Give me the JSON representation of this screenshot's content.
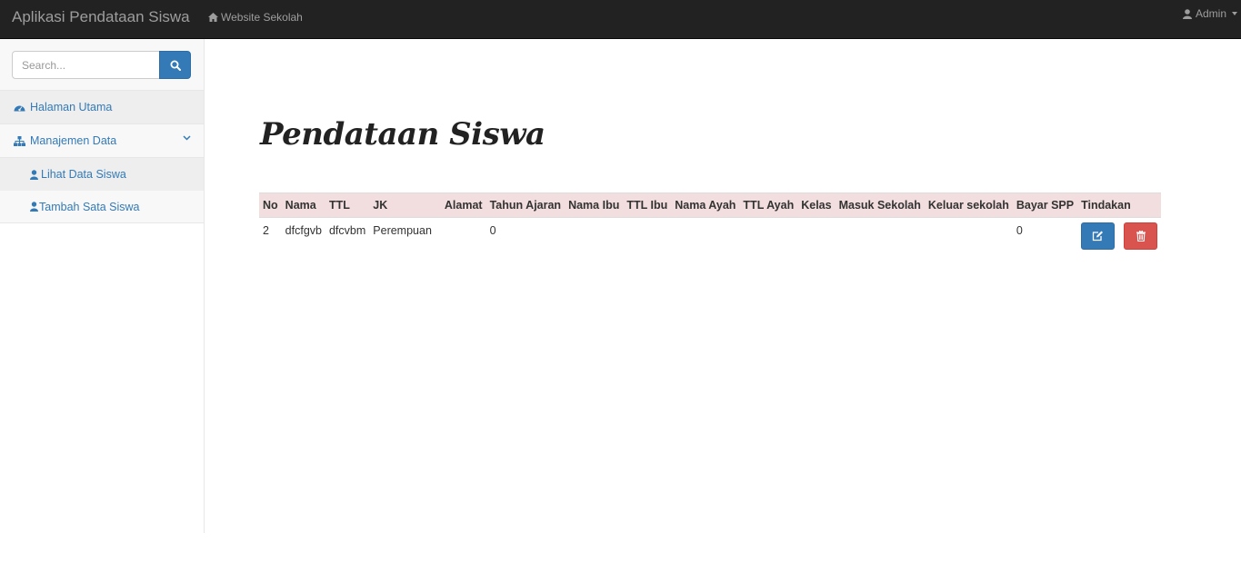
{
  "navbar": {
    "brand": "Aplikasi Pendataan Siswa",
    "website_link": "Website Sekolah",
    "user": "Admin"
  },
  "sidebar": {
    "search_placeholder": "Search...",
    "items": [
      {
        "label": "Halaman Utama",
        "icon": "dashboard-icon"
      },
      {
        "label": "Manajemen Data",
        "icon": "sitemap-icon"
      },
      {
        "label": "Lihat Data Siswa",
        "icon": "user-icon"
      },
      {
        "label": "Tambah Sata Siswa",
        "icon": "user-icon"
      }
    ]
  },
  "main": {
    "title": "Pendataan Siswa",
    "table": {
      "headers": [
        "No",
        "Nama",
        "TTL",
        "JK",
        "Alamat",
        "Tahun Ajaran",
        "Nama Ibu",
        "TTL Ibu",
        "Nama Ayah",
        "TTL Ayah",
        "Kelas",
        "Masuk Sekolah",
        "Keluar sekolah",
        "Bayar SPP",
        "Tindakan"
      ],
      "rows": [
        [
          "2",
          "dfcfgvb",
          "dfcvbm",
          "Perempuan",
          "",
          "0",
          "",
          "",
          "",
          "",
          "",
          "",
          "",
          "0"
        ]
      ]
    }
  },
  "colors": {
    "navbar_bg": "#222222",
    "primary": "#337ab7",
    "danger": "#d9534f",
    "table_header_bg": "#f2dede"
  }
}
